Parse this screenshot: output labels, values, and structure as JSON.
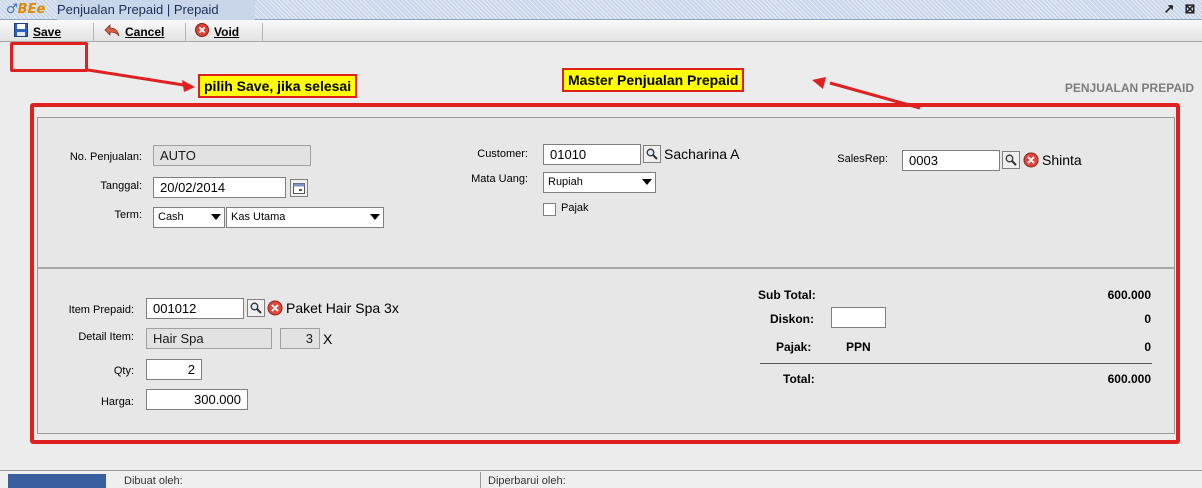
{
  "window": {
    "logo_text": "BEe",
    "title": "Penjualan Prepaid | Prepaid",
    "restore_glyph": "↗",
    "close_glyph": "⊠"
  },
  "toolbar": {
    "save_label": "Save",
    "cancel_label": "Cancel",
    "void_label": "Void"
  },
  "annotations": {
    "save_hint": "pilih Save, jika selesai",
    "master_hint": "Master Penjualan Prepaid",
    "color": "#e02020",
    "fill": "#ffff00"
  },
  "page_heading": "PENJUALAN PREPAID",
  "header": {
    "no_penjualan": {
      "label": "No. Penjualan:",
      "value": "AUTO"
    },
    "tanggal": {
      "label": "Tanggal:",
      "value": "20/02/2014"
    },
    "term": {
      "label": "Term:",
      "type": "Cash",
      "account": "Kas Utama"
    },
    "customer": {
      "label": "Customer:",
      "code": "01010",
      "name": "Sacharina A"
    },
    "mata_uang": {
      "label": "Mata Uang:",
      "value": "Rupiah"
    },
    "pajak": {
      "label": "Pajak",
      "checked": false
    },
    "salesrep": {
      "label": "SalesRep:",
      "code": "0003",
      "name": "Shinta"
    }
  },
  "item": {
    "item_prepaid": {
      "label": "Item Prepaid:",
      "code": "001012",
      "name": "Paket Hair Spa 3x"
    },
    "detail_item": {
      "label": "Detail Item:",
      "name": "Hair Spa",
      "count": "3",
      "suffix": "X"
    },
    "qty": {
      "label": "Qty:",
      "value": "2"
    },
    "harga": {
      "label": "Harga:",
      "value": "300.000"
    }
  },
  "totals": {
    "sub_total": {
      "label": "Sub Total:",
      "value": "600.000"
    },
    "diskon": {
      "label": "Diskon:",
      "input": "",
      "value": "0"
    },
    "pajak": {
      "label": "Pajak:",
      "tax_name": "PPN",
      "value": "0"
    },
    "total": {
      "label": "Total:",
      "value": "600.000"
    }
  },
  "status": {
    "created_by": "Dibuat oleh:",
    "updated_by": "Diperbarui oleh:"
  }
}
